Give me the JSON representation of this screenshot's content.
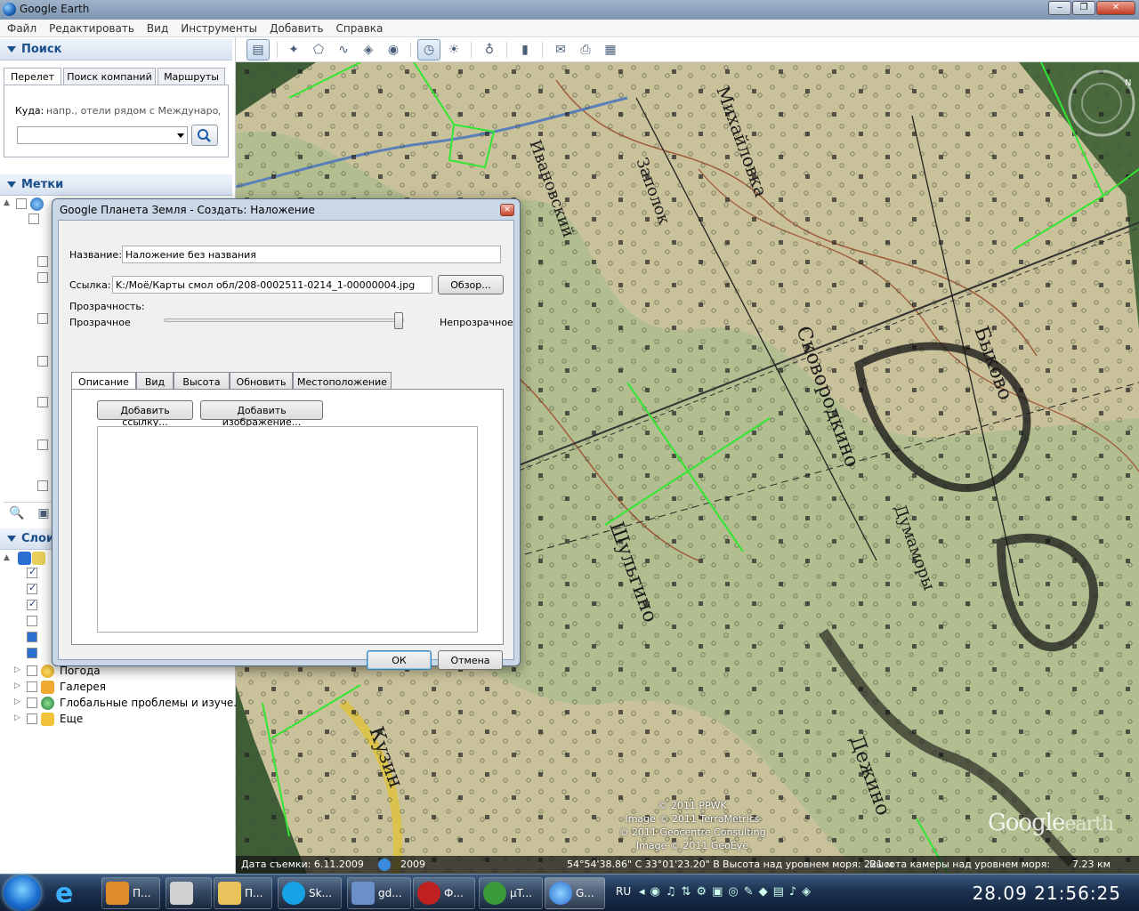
{
  "window": {
    "title": "Google Earth"
  },
  "menu": [
    "Файл",
    "Редактировать",
    "Вид",
    "Инструменты",
    "Добавить",
    "Справка"
  ],
  "search": {
    "header": "Поиск",
    "tabs": [
      "Перелет",
      "Поиск компаний",
      "Маршруты"
    ],
    "where_label": "Куда:",
    "where_hint": "напр., отели рядом с Международным",
    "query": ""
  },
  "places": {
    "header": "Метки"
  },
  "layers": {
    "header": "Слои",
    "items": [
      {
        "label": "Погода",
        "checked": false
      },
      {
        "label": "Галерея",
        "checked": false
      },
      {
        "label": "Глобальные проблемы и изуче...",
        "checked": false
      },
      {
        "label": "Еще",
        "checked": false
      }
    ]
  },
  "dialog": {
    "title": "Google Планета Земля - Создать: Наложение",
    "name_label": "Название:",
    "name_value": "Наложение без названия",
    "link_label": "Ссылка:",
    "link_value": "K:/Моё/Карты смол обл/208-0002511-0214_1-00000004.jpg",
    "browse_button": "Обзор...",
    "transparency_label": "Прозрачность:",
    "transparent_label": "Прозрачное",
    "opaque_label": "Непрозрачное",
    "opacity": 1.0,
    "tabs": [
      "Описание",
      "Вид",
      "Высота",
      "Обновить",
      "Местоположение"
    ],
    "add_link_button": "Добавить ссылку...",
    "add_image_button": "Добавить изображение...",
    "ok_button": "ОК",
    "cancel_button": "Отмена",
    "description": ""
  },
  "map": {
    "credits": [
      "© 2011 PPWK",
      "Image © 2011 TerraMetrics",
      "© 2011 Geocentre Consulting",
      "Image © 2011 GeoEye"
    ],
    "logo_main": "Google",
    "logo_sub": "earth",
    "labels": [
      "Сковородкино",
      "Быково",
      "Шульгино",
      "Думаморы",
      "Дежино",
      "Кузин",
      "Заполок",
      "Ивановский",
      "Михайловка"
    ]
  },
  "status": {
    "date_text": "Дата съемки: 6.11.2009",
    "year": "2009",
    "coords": "54°54'38.86\" С  33°01'23.20\" В",
    "elevation": "Высота над уровнем моря: 221 м",
    "eye_alt": "Высота камеры над уровнем моря:",
    "eye_value": "7.23 км"
  },
  "taskbar": {
    "items": [
      {
        "label": "П...",
        "color": "#e08a2c"
      },
      {
        "label": "",
        "color": "#d0d0d0"
      },
      {
        "label": "П...",
        "color": "#e8c25a"
      },
      {
        "label": "Sk...",
        "color": "#16a3e6"
      },
      {
        "label": "gd...",
        "color": "#6b8fc8"
      },
      {
        "label": "Ф...",
        "color": "#c02020"
      },
      {
        "label": "µT...",
        "color": "#3a9a3a"
      },
      {
        "label": "G...",
        "color": "#2a6fd1"
      }
    ],
    "lang": "RU",
    "clock": "28.09 21:56:25"
  }
}
